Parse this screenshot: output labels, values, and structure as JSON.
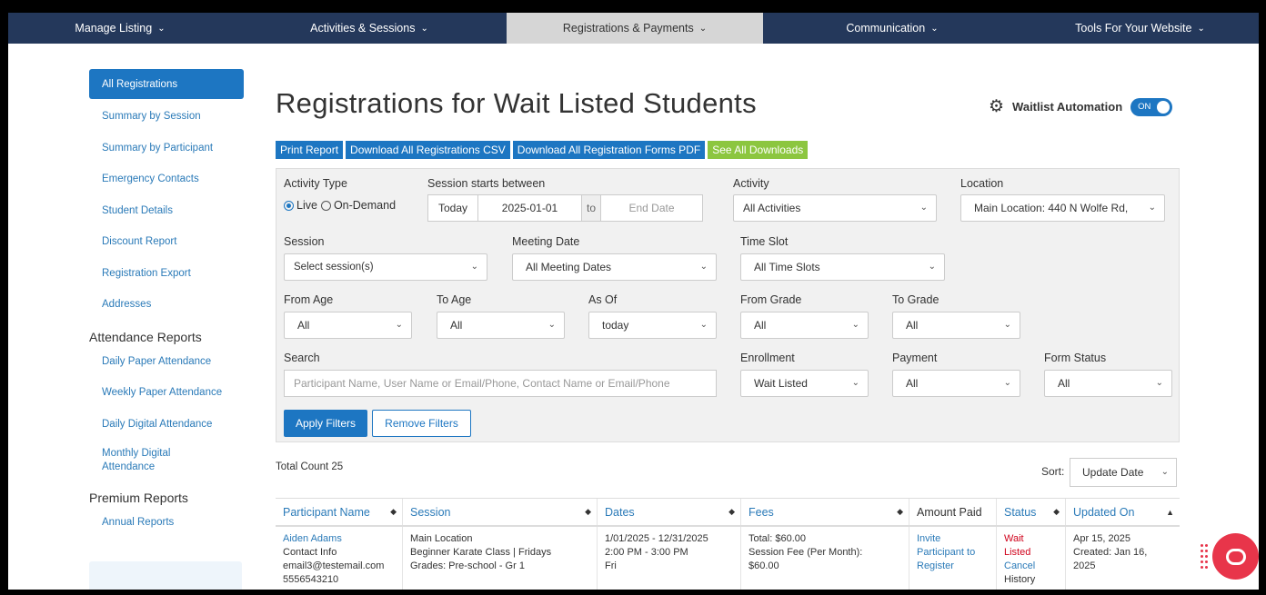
{
  "nav": [
    {
      "label": "Manage Listing",
      "active": false
    },
    {
      "label": "Activities & Sessions",
      "active": false
    },
    {
      "label": "Registrations & Payments",
      "active": true
    },
    {
      "label": "Communication",
      "active": false
    },
    {
      "label": "Tools For Your Website",
      "active": false
    }
  ],
  "sidebar": {
    "links1": [
      "All Registrations",
      "Summary by Session",
      "Summary by Participant",
      "Emergency Contacts",
      "Student Details",
      "Discount Report",
      "Registration Export",
      "Addresses"
    ],
    "attendance_heading": "Attendance Reports",
    "attendance_links": [
      "Daily Paper Attendance",
      "Weekly Paper Attendance",
      "Daily Digital Attendance",
      "Monthly Digital Attendance"
    ],
    "premium_heading": "Premium Reports",
    "premium_links": [
      "Annual Reports"
    ]
  },
  "page": {
    "title": "Registrations for Wait Listed Students",
    "automation_label": "Waitlist Automation",
    "automation_toggle": "ON"
  },
  "actions": {
    "print": "Print Report",
    "csv": "Download All Registrations CSV",
    "pdf": "Download All Registration Forms PDF",
    "all": "See All Downloads"
  },
  "filters": {
    "activity_type_label": "Activity Type",
    "live": "Live",
    "on_demand": "On-Demand",
    "session_starts_label": "Session starts between",
    "today": "Today",
    "start_date": "2025-01-01",
    "to": "to",
    "end_date_placeholder": "End Date",
    "activity_label": "Activity",
    "activity_value": "All Activities",
    "location_label": "Location",
    "location_value": "Main Location: 440 N Wolfe Rd,",
    "session_label": "Session",
    "session_value": "Select session(s)",
    "meeting_date_label": "Meeting Date",
    "meeting_date_value": "All Meeting Dates",
    "time_slot_label": "Time Slot",
    "time_slot_value": "All Time Slots",
    "from_age_label": "From Age",
    "from_age_value": "All",
    "to_age_label": "To Age",
    "to_age_value": "All",
    "as_of_label": "As Of",
    "as_of_value": "today",
    "from_grade_label": "From Grade",
    "from_grade_value": "All",
    "to_grade_label": "To Grade",
    "to_grade_value": "All",
    "search_label": "Search",
    "search_placeholder": "Participant Name, User Name or Email/Phone, Contact Name or Email/Phone",
    "enrollment_label": "Enrollment",
    "enrollment_value": "Wait Listed",
    "payment_label": "Payment",
    "payment_value": "All",
    "form_status_label": "Form Status",
    "form_status_value": "All",
    "apply": "Apply Filters",
    "remove": "Remove Filters"
  },
  "results": {
    "total": "Total Count 25",
    "sort_label": "Sort:",
    "sort_value": "Update Date"
  },
  "table": {
    "headers": [
      "Participant Name",
      "Session",
      "Dates",
      "Fees",
      "Amount Paid",
      "Status",
      "Updated On"
    ],
    "row": {
      "name": "Aiden Adams",
      "contact_info": "Contact Info",
      "email": "email3@testemail.com",
      "phone": "5556543210",
      "session_location": "Main Location",
      "session_class": "Beginner Karate Class | Fridays",
      "session_grades": "Grades: Pre-school - Gr 1",
      "date_range": "1/01/2025 - 12/31/2025",
      "time": "2:00 PM - 3:00 PM",
      "day": "Fri",
      "fee_total": "Total: $60.00",
      "fee_session": "Session Fee (Per Month):",
      "fee_amount": "$60.00",
      "paid_line1": "Invite",
      "paid_line2": "Participant to",
      "paid_line3": "Register",
      "status_line1": "Wait",
      "status_line2": "Listed",
      "status_cancel": "Cancel",
      "status_history": "History",
      "updated": "Apr 15, 2025",
      "created_line1": "Created: Jan 16,",
      "created_line2": "2025"
    }
  }
}
